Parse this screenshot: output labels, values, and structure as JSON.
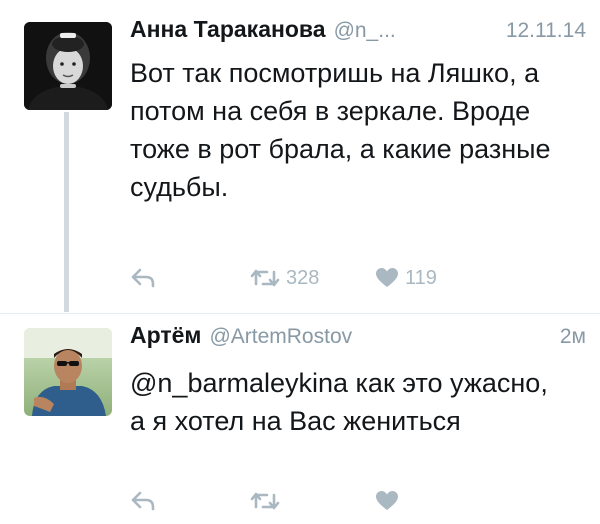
{
  "tweets": [
    {
      "author_name": "Анна Тараканова",
      "handle": "@n_...",
      "time": "12.11.14",
      "text": "Вот так посмотришь на Ляшко, а потом на себя в зеркале. Вроде тоже в рот брала, а какие разные судьбы.",
      "retweets": "328",
      "likes": "119"
    },
    {
      "author_name": "Артём",
      "handle": "@ArtemRostov",
      "time": "2м",
      "text": "@n_barmaleykina как это ужасно, а я хотел на Вас жениться",
      "retweets": "",
      "likes": ""
    }
  ],
  "icons": {
    "reply": "reply-icon",
    "retweet": "retweet-icon",
    "like": "heart-icon"
  },
  "colors": {
    "text": "#14171a",
    "secondary": "#8899a6",
    "action_icon": "#aab8c2",
    "thread_line": "#d3d9de"
  }
}
